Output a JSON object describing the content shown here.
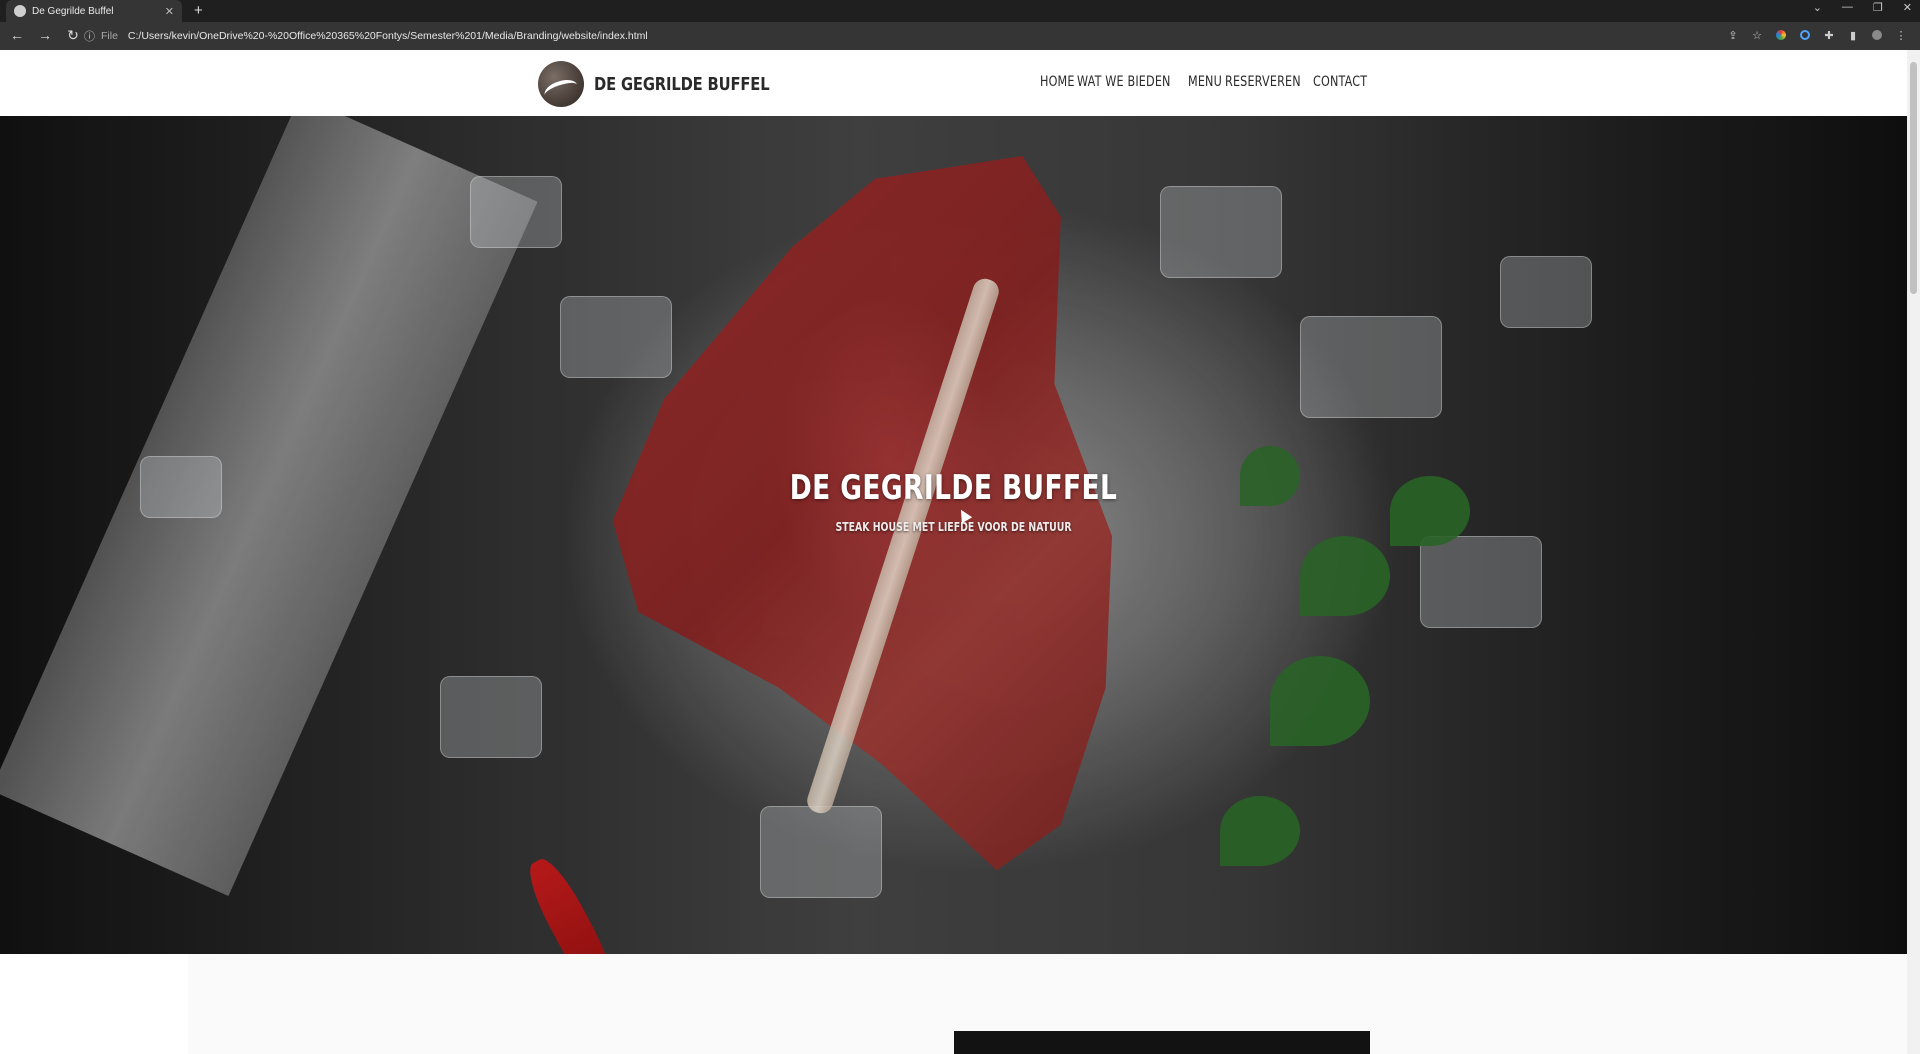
{
  "browser": {
    "tab_title": "De Gegrilde Buffel",
    "tab_close": "✕",
    "new_tab": "+",
    "scheme": "File",
    "url": "C:/Users/kevin/OneDrive%20-%20Office%20365%20Fontys/Semester%201/Media/Branding/website/index.html",
    "window_controls": [
      "⌄",
      "—",
      "❐",
      "✕"
    ],
    "nav": {
      "back": "←",
      "forward": "→",
      "reload": "↻"
    },
    "info_icon": "ⓘ",
    "toolbar_icons": [
      "share-icon",
      "star-icon",
      "color-extension-icon",
      "circle-extension-icon",
      "puzzle-icon",
      "sidepanel-icon",
      "profile-icon",
      "menu-icon"
    ]
  },
  "site": {
    "brand": "DE GEGRILDE BUFFEL",
    "nav": [
      "HOME",
      "WAT WE BIEDEN",
      "MENU",
      "RESERVEREN",
      "CONTACT"
    ]
  },
  "hero": {
    "title": "DE GEGRILDE BUFFEL",
    "subtitle": "STEAK HOUSE MET LIEFDE VOOR DE NATUUR"
  },
  "colors": {
    "header_bg": "#ffffff",
    "text_dark": "#2a2a2a",
    "hero_text": "#ffffff",
    "chrome_dark": "#1f1f1f",
    "accent_steak": "#9e2e2c"
  }
}
